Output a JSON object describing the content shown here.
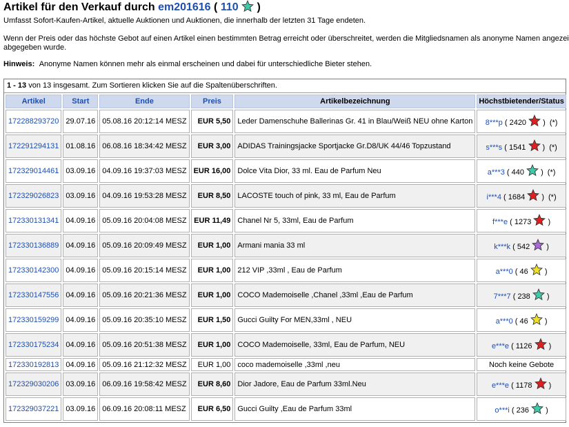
{
  "header": {
    "title_prefix": "Artikel für den Verkauf durch",
    "username": "em201616",
    "paren_open": "(",
    "feedback_score": "110",
    "paren_close": ")",
    "star_color": "#3ec9a8"
  },
  "intro": "Umfasst Sofort-Kaufen-Artikel, aktuelle Auktionen und Auktionen, die innerhalb der letzten 31 Tage endeten.",
  "notice": "Wenn der Preis oder das höchste Gebot auf einen Artikel einen bestimmten Betrag erreicht oder überschreitet, werden die Mitgliedsnamen als anonyme Namen angezeigt abgegeben wurde.",
  "hint": {
    "label": "Hinweis:",
    "text": "Anonyme Namen können mehr als einmal erscheinen und dabei für unterschiedliche Bieter stehen."
  },
  "table": {
    "range": "1 - 13",
    "info_text": "von 13 insgesamt. Zum Sortieren klicken Sie auf die Spaltenüberschriften.",
    "columns": [
      "Artikel",
      "Start",
      "Ende",
      "Preis",
      "Artikelbezeichnung",
      "Höchstbietender/Status"
    ],
    "rows": [
      {
        "id": "172288293720",
        "start": "29.07.16",
        "end": "05.08.16 20:12:14 MESZ",
        "price": "EUR 5,50",
        "title": "Leder Damenschuhe Ballerinas Gr. 41 in Blau/Weiß NEU ohne Karton",
        "bidder": "8***p",
        "score": "2420",
        "star": "#e02020",
        "note": "(*)",
        "bold": true
      },
      {
        "id": "172291294131",
        "start": "01.08.16",
        "end": "06.08.16 18:34:42 MESZ",
        "price": "EUR 3,00",
        "title": "ADIDAS Trainingsjacke Sportjacke Gr.D8/UK 44/46 Topzustand",
        "bidder": "s***s",
        "score": "1541",
        "star": "#e02020",
        "note": "(*)",
        "bold": true
      },
      {
        "id": "172329014461",
        "start": "03.09.16",
        "end": "04.09.16 19:37:03 MESZ",
        "price": "EUR 16,00",
        "title": "Dolce Vita Dior, 33 ml. Eau de Parfum Neu",
        "bidder": "a***3",
        "score": "440",
        "star": "#3ec9a8",
        "note": "(*)",
        "bold": true
      },
      {
        "id": "172329026823",
        "start": "03.09.16",
        "end": "04.09.16 19:53:28 MESZ",
        "price": "EUR 8,50",
        "title": "LACOSTE touch of pink, 33 ml, Eau de Parfum",
        "bidder": "i***4",
        "score": "1684",
        "star": "#e02020",
        "note": "(*)",
        "bold": true
      },
      {
        "id": "172330131341",
        "start": "04.09.16",
        "end": "05.09.16 20:04:08 MESZ",
        "price": "EUR 11,49",
        "title": "Chanel Nr 5, 33ml, Eau de Parfum",
        "bidder": "f***e",
        "score": "1273",
        "star": "#e02020",
        "note": "",
        "bold": true
      },
      {
        "id": "172330136889",
        "start": "04.09.16",
        "end": "05.09.16 20:09:49 MESZ",
        "price": "EUR 1,00",
        "title": "Armani mania 33 ml",
        "bidder": "k***k",
        "score": "542",
        "star": "#a86ad8",
        "note": "",
        "bold": true
      },
      {
        "id": "172330142300",
        "start": "04.09.16",
        "end": "05.09.16 20:15:14 MESZ",
        "price": "EUR 1,00",
        "title": "212 VIP ,33ml , Eau de Parfum",
        "bidder": "a***0",
        "score": "46",
        "star": "#f0e020",
        "note": "",
        "bold": true
      },
      {
        "id": "172330147556",
        "start": "04.09.16",
        "end": "05.09.16 20:21:36 MESZ",
        "price": "EUR 1,00",
        "title": "COCO Mademoiselle ,Chanel ,33ml ,Eau de Parfum",
        "bidder": "7***7",
        "score": "238",
        "star": "#3ec9a8",
        "note": "",
        "bold": true
      },
      {
        "id": "172330159299",
        "start": "04.09.16",
        "end": "05.09.16 20:35:10 MESZ",
        "price": "EUR 1,50",
        "title": "Gucci Guilty For MEN,33ml , NEU",
        "bidder": "a***0",
        "score": "46",
        "star": "#f0e020",
        "note": "",
        "bold": true
      },
      {
        "id": "172330175234",
        "start": "04.09.16",
        "end": "05.09.16 20:51:38 MESZ",
        "price": "EUR 1,00",
        "title": "COCO Mademoiselle, 33ml, Eau de Parfum, NEU",
        "bidder": "e***e",
        "score": "1126",
        "star": "#e02020",
        "note": "",
        "bold": true
      },
      {
        "id": "172330192813",
        "start": "04.09.16",
        "end": "05.09.16 21:12:32 MESZ",
        "price": "EUR 1,00",
        "title": "coco mademoiselle ,33ml ,neu",
        "status_text": "Noch keine Gebote",
        "bold": false
      },
      {
        "id": "172329030206",
        "start": "03.09.16",
        "end": "06.09.16 19:58:42 MESZ",
        "price": "EUR 8,60",
        "title": "Dior Jadore, Eau de Parfum 33ml.Neu",
        "bidder": "e***e",
        "score": "1178",
        "star": "#e02020",
        "note": "",
        "bold": true
      },
      {
        "id": "172329037221",
        "start": "03.09.16",
        "end": "06.09.16 20:08:11 MESZ",
        "price": "EUR 6,50",
        "title": "Gucci Guilty ,Eau de Parfum 33ml",
        "bidder": "o***i",
        "score": "236",
        "star": "#3ec9a8",
        "note": "",
        "bold": true
      }
    ]
  }
}
